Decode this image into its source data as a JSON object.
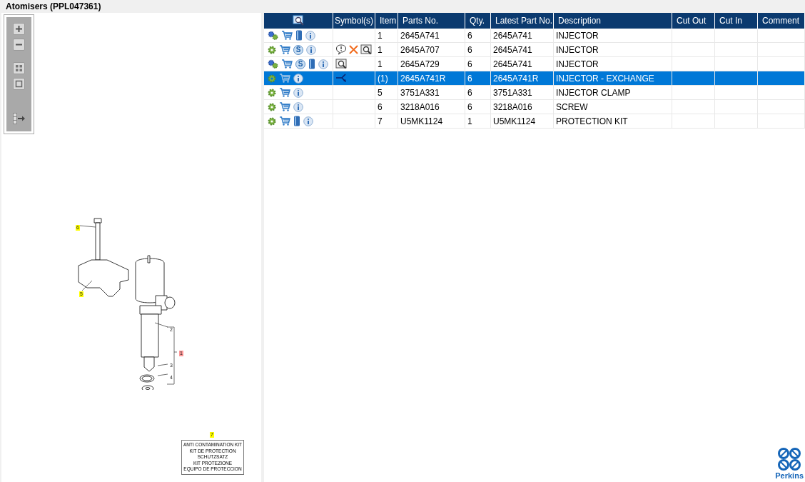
{
  "title": "Atomisers (PPL047361)",
  "diagram": {
    "callouts": [
      {
        "label": "6",
        "color": "#ffff00"
      },
      {
        "label": "5",
        "color": "#ffff00"
      },
      {
        "label": "2"
      },
      {
        "label": "1",
        "color": "#ff9999"
      },
      {
        "label": "3"
      },
      {
        "label": "4"
      },
      {
        "label": "7",
        "color": "#ffff00"
      }
    ],
    "kit_lines": [
      "ANTI CONTAMINATION KIT",
      "KIT DE PROTECTION",
      "SCHUTZSATZ",
      "KIT PROTEZIONE",
      "EQUIPO DE PROTECCION"
    ]
  },
  "table": {
    "columns": [
      "Symbol(s)",
      "Item",
      "Parts No.",
      "Qty.",
      "Latest Part No.",
      "Description",
      "Cut Out",
      "Cut In",
      "Comment"
    ],
    "rows": [
      {
        "selected": false,
        "icons": [
          {
            "kind": "gears"
          },
          {
            "kind": "cart"
          },
          {
            "kind": "book"
          },
          {
            "kind": "info"
          }
        ],
        "symbols": [],
        "item": "1",
        "part_no": "2645A741",
        "qty": "6",
        "latest": "2645A741",
        "description": "INJECTOR"
      },
      {
        "selected": false,
        "icons": [
          {
            "kind": "gear"
          },
          {
            "kind": "cart"
          },
          {
            "kind": "coin",
            "label": "S"
          },
          {
            "kind": "info"
          }
        ],
        "symbols": [
          {
            "kind": "comment"
          },
          {
            "kind": "cross"
          },
          {
            "kind": "lookup"
          }
        ],
        "item": "1",
        "part_no": "2645A707",
        "qty": "6",
        "latest": "2645A741",
        "description": "INJECTOR"
      },
      {
        "selected": false,
        "icons": [
          {
            "kind": "gears"
          },
          {
            "kind": "cart"
          },
          {
            "kind": "coin",
            "label": "S"
          },
          {
            "kind": "book"
          },
          {
            "kind": "info"
          }
        ],
        "symbols": [
          {
            "kind": "lookup"
          }
        ],
        "item": "1",
        "part_no": "2645A729",
        "qty": "6",
        "latest": "2645A741",
        "description": "INJECTOR"
      },
      {
        "selected": true,
        "icons": [
          {
            "kind": "gear"
          },
          {
            "kind": "cart"
          },
          {
            "kind": "info"
          }
        ],
        "symbols": [
          {
            "kind": "merge"
          }
        ],
        "item": "(1)",
        "part_no": "2645A741R",
        "qty": "6",
        "latest": "2645A741R",
        "description": "INJECTOR - EXCHANGE"
      },
      {
        "selected": false,
        "icons": [
          {
            "kind": "gear"
          },
          {
            "kind": "cart"
          },
          {
            "kind": "info"
          }
        ],
        "symbols": [],
        "item": "5",
        "part_no": "3751A331",
        "qty": "6",
        "latest": "3751A331",
        "description": "INJECTOR CLAMP"
      },
      {
        "selected": false,
        "icons": [
          {
            "kind": "gear"
          },
          {
            "kind": "cart"
          },
          {
            "kind": "info"
          }
        ],
        "symbols": [],
        "item": "6",
        "part_no": "3218A016",
        "qty": "6",
        "latest": "3218A016",
        "description": "SCREW"
      },
      {
        "selected": false,
        "icons": [
          {
            "kind": "gear"
          },
          {
            "kind": "cart"
          },
          {
            "kind": "book"
          },
          {
            "kind": "info"
          }
        ],
        "symbols": [],
        "item": "7",
        "part_no": "U5MK1124",
        "qty": "1",
        "latest": "U5MK1124",
        "description": "PROTECTION KIT"
      }
    ]
  },
  "logo": {
    "text": "Perkins"
  }
}
